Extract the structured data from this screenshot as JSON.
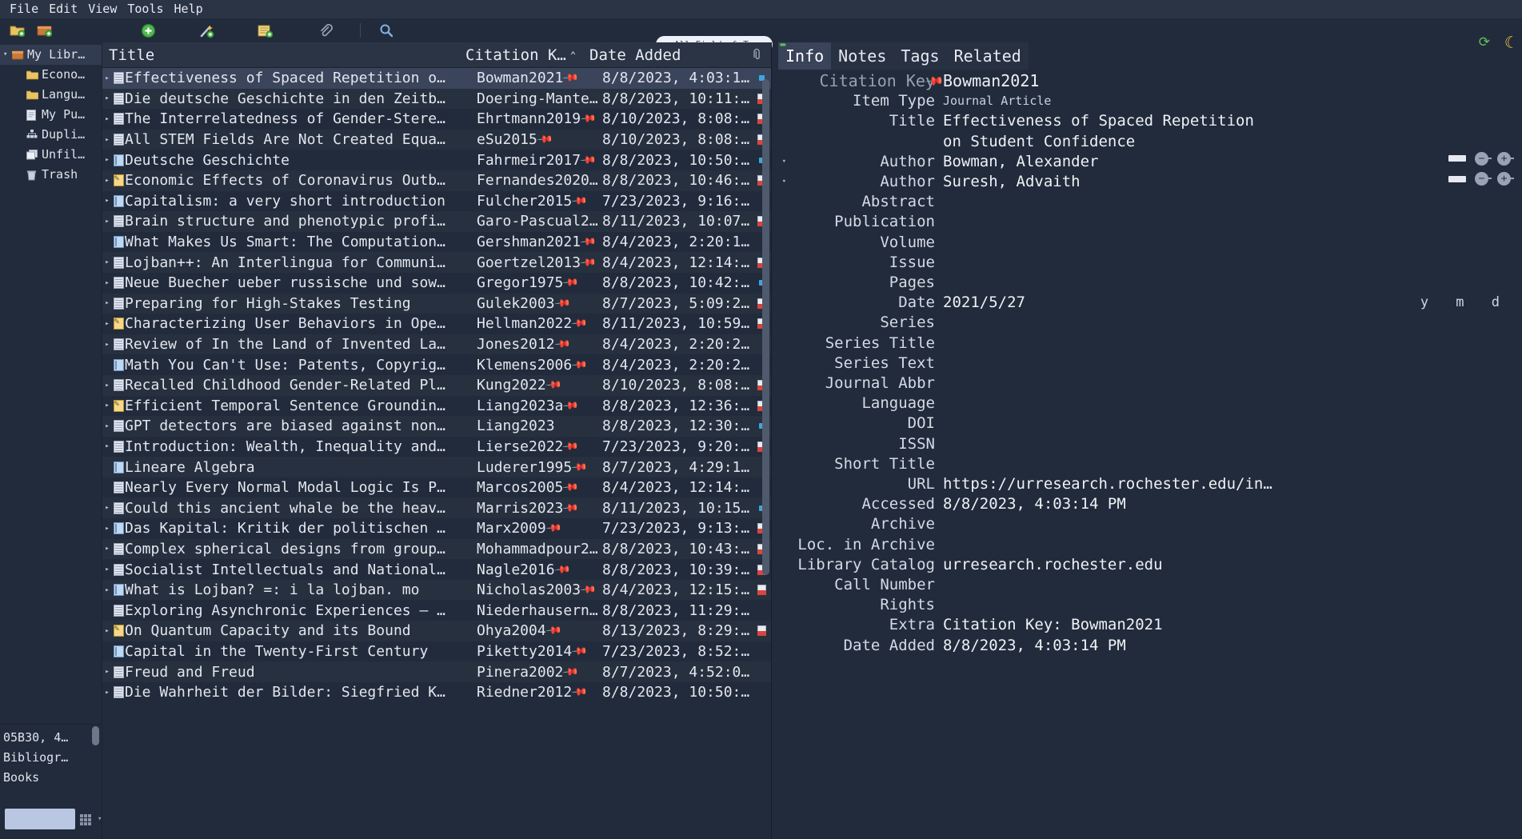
{
  "menu": {
    "items": [
      "File",
      "Edit",
      "View",
      "Tools",
      "Help"
    ]
  },
  "toolbar": {
    "new_collection_label": "new-collection",
    "new_library_label": "new-library",
    "new_item_label": "new-item",
    "add_by_identifier_label": "add-by-identifier",
    "new_note_label": "new-note",
    "add_attachment_label": "add-attachment",
    "advanced_search_label": "advanced-search",
    "sync_label": "sync",
    "appearance_label": "dark-mode"
  },
  "search": {
    "placeholder": "All Fields & Ta",
    "value": "",
    "scope": "All Fields & Ta"
  },
  "sidebar": {
    "collections": [
      {
        "label": "My Libr…",
        "icon": "library-icon",
        "level": 0,
        "twisty": "▾",
        "selected": true
      },
      {
        "label": "Econo…",
        "icon": "folder-icon",
        "level": 1,
        "twisty": "",
        "selected": false
      },
      {
        "label": "Langu…",
        "icon": "folder-icon",
        "level": 1,
        "twisty": "",
        "selected": false
      },
      {
        "label": "My Pu…",
        "icon": "publications-icon",
        "level": 1,
        "twisty": "",
        "selected": false
      },
      {
        "label": "Dupli…",
        "icon": "duplicates-icon",
        "level": 1,
        "twisty": "",
        "selected": false
      },
      {
        "label": "Unfil…",
        "icon": "unfiled-icon",
        "level": 1,
        "twisty": "",
        "selected": false
      },
      {
        "label": "Trash",
        "icon": "trash-icon",
        "level": 1,
        "twisty": "",
        "selected": false
      }
    ],
    "tags": [
      "05B30, 4…",
      "Bibliogr…",
      "Books"
    ],
    "tag_filter_value": ""
  },
  "items_pane": {
    "columns": [
      {
        "key": "title",
        "label": "Title",
        "sorted": false
      },
      {
        "key": "citationKey",
        "label": "Citation K…",
        "sorted": true,
        "direction": "ascending",
        "arrow": "⌃"
      },
      {
        "key": "dateAdded",
        "label": "Date Added",
        "sorted": false
      }
    ],
    "rows": [
      {
        "twisty": "▸",
        "type": "doc",
        "title": "Effectiveness of Spaced Repetition o…",
        "key": "Bowman2021",
        "pinned": true,
        "date": "8/8/2023, 4:03:1…",
        "att": "blue",
        "selected": true
      },
      {
        "twisty": "▸",
        "type": "doc",
        "title": "Die deutsche Geschichte in den Zeitb…",
        "key": "Doering-Mante…",
        "pinned": false,
        "date": "8/8/2023, 10:11:…",
        "att": "pdf"
      },
      {
        "twisty": "▸",
        "type": "doc",
        "title": "The Interrelatedness of Gender-Stere…",
        "key": "Ehrtmann2019",
        "pinned": true,
        "date": "8/10/2023, 8:08:…",
        "att": "pdf"
      },
      {
        "twisty": "▸",
        "type": "doc",
        "title": "All STEM Fields Are Not Created Equa…",
        "key": "eSu2015",
        "pinned": true,
        "date": "8/10/2023, 8:08:…",
        "att": "pdf"
      },
      {
        "twisty": "▸",
        "type": "book",
        "title": "Deutsche Geschichte",
        "key": "Fahrmeir2017",
        "pinned": true,
        "date": "8/8/2023, 10:50:…",
        "att": "blue"
      },
      {
        "twisty": "▸",
        "type": "prep",
        "title": "Economic Effects of Coronavirus Outb…",
        "key": "Fernandes2020…",
        "pinned": false,
        "date": "8/8/2023, 10:46:…",
        "att": "pdf"
      },
      {
        "twisty": "▸",
        "type": "book",
        "title": "Capitalism: a very short introduction",
        "key": "Fulcher2015",
        "pinned": true,
        "date": "7/23/2023, 9:16:…",
        "att": ""
      },
      {
        "twisty": "▸",
        "type": "doc",
        "title": "Brain structure and phenotypic profi…",
        "key": "Garo-Pascual2…",
        "pinned": false,
        "date": "8/11/2023, 10:07…",
        "att": "pdf"
      },
      {
        "twisty": "",
        "type": "book",
        "title": "What Makes Us Smart: The Computation…",
        "key": "Gershman2021",
        "pinned": true,
        "date": "8/4/2023, 2:20:1…",
        "att": ""
      },
      {
        "twisty": "▸",
        "type": "doc",
        "title": "Lojban++: An Interlingua for Communi…",
        "key": "Goertzel2013",
        "pinned": true,
        "date": "8/4/2023, 12:14:…",
        "att": "pdf"
      },
      {
        "twisty": "▸",
        "type": "doc",
        "title": "Neue Buecher ueber russische und sow…",
        "key": "Gregor1975",
        "pinned": true,
        "date": "8/8/2023, 10:42:…",
        "att": "blue"
      },
      {
        "twisty": "▸",
        "type": "doc",
        "title": "Preparing for High-Stakes Testing",
        "key": "Gulek2003",
        "pinned": true,
        "date": "8/7/2023, 5:09:2…",
        "att": "pdf"
      },
      {
        "twisty": "▸",
        "type": "prep",
        "title": "Characterizing User Behaviors in Ope…",
        "key": "Hellman2022",
        "pinned": true,
        "date": "8/11/2023, 10:59…",
        "att": "pdf"
      },
      {
        "twisty": "▸",
        "type": "doc",
        "title": "Review of In the Land of Invented La…",
        "key": "Jones2012",
        "pinned": true,
        "date": "8/4/2023, 2:20:2…",
        "att": ""
      },
      {
        "twisty": "",
        "type": "book",
        "title": "Math You Can't Use: Patents, Copyrig…",
        "key": "Klemens2006",
        "pinned": true,
        "date": "8/4/2023, 2:20:2…",
        "att": ""
      },
      {
        "twisty": "▸",
        "type": "doc",
        "title": "Recalled Childhood Gender-Related Pl…",
        "key": "Kung2022",
        "pinned": true,
        "date": "8/10/2023, 8:08:…",
        "att": "pdf"
      },
      {
        "twisty": "▸",
        "type": "prep",
        "title": "Efficient Temporal Sentence Groundin…",
        "key": "Liang2023a",
        "pinned": true,
        "date": "8/8/2023, 12:36:…",
        "att": "pdf"
      },
      {
        "twisty": "▸",
        "type": "doc",
        "title": "GPT detectors are biased against non…",
        "key": "Liang2023",
        "pinned": false,
        "date": "8/8/2023, 12:30:…",
        "att": "blue"
      },
      {
        "twisty": "▸",
        "type": "doc",
        "title": "Introduction: Wealth, Inequality and…",
        "key": "Lierse2022",
        "pinned": true,
        "date": "7/23/2023, 9:20:…",
        "att": "pdf"
      },
      {
        "twisty": "",
        "type": "book",
        "title": "Lineare Algebra",
        "key": "Luderer1995",
        "pinned": true,
        "date": "8/7/2023, 4:29:1…",
        "att": ""
      },
      {
        "twisty": "",
        "type": "doc",
        "title": "Nearly Every Normal Modal Logic Is P…",
        "key": "Marcos2005",
        "pinned": true,
        "date": "8/4/2023, 12:14:…",
        "att": ""
      },
      {
        "twisty": "▸",
        "type": "doc",
        "title": "Could this ancient whale be the heav…",
        "key": "Marris2023",
        "pinned": true,
        "date": "8/11/2023, 10:15…",
        "att": "blue"
      },
      {
        "twisty": "▸",
        "type": "book",
        "title": "Das Kapital: Kritik der politischen …",
        "key": "Marx2009",
        "pinned": true,
        "date": "7/23/2023, 9:13:…",
        "att": "pdf"
      },
      {
        "twisty": "▸",
        "type": "doc",
        "title": "Complex spherical designs from group…",
        "key": "Mohammadpour2…",
        "pinned": false,
        "date": "8/8/2023, 10:43:…",
        "att": "pdf"
      },
      {
        "twisty": "▸",
        "type": "doc",
        "title": "Socialist Intellectuals and National…",
        "key": "Nagle2016",
        "pinned": true,
        "date": "8/8/2023, 10:39:…",
        "att": "pdf"
      },
      {
        "twisty": "▸",
        "type": "book",
        "title": "What is Lojban? =: i la lojban. mo",
        "key": "Nicholas2003",
        "pinned": true,
        "date": "8/4/2023, 12:15:…",
        "att": "pdf"
      },
      {
        "twisty": "",
        "type": "doc",
        "title": "Exploring Asynchronic Experiences – …",
        "key": "Niederhausern…",
        "pinned": false,
        "date": "8/8/2023, 11:29:…",
        "att": ""
      },
      {
        "twisty": "▸",
        "type": "prep",
        "title": "On Quantum Capacity and its Bound",
        "key": "Ohya2004",
        "pinned": true,
        "date": "8/13/2023, 8:29:…",
        "att": "pdf"
      },
      {
        "twisty": "",
        "type": "book",
        "title": "Capital in the Twenty-First Century",
        "key": "Piketty2014",
        "pinned": true,
        "date": "7/23/2023, 8:52:…",
        "att": ""
      },
      {
        "twisty": "▸",
        "type": "doc",
        "title": "Freud and Freud",
        "key": "Pinera2002",
        "pinned": true,
        "date": "8/7/2023, 4:52:0…",
        "att": ""
      },
      {
        "twisty": "▸",
        "type": "doc",
        "title": "Die Wahrheit der Bilder: Siegfried K…",
        "key": "Riedner2012",
        "pinned": true,
        "date": "8/8/2023, 10:50:…",
        "att": ""
      }
    ]
  },
  "right_pane": {
    "tabs": [
      {
        "label": "Info",
        "active": true
      },
      {
        "label": "Notes",
        "active": false
      },
      {
        "label": "Tags",
        "active": false
      },
      {
        "label": "Related",
        "active": false
      }
    ],
    "citation_key_label": "Citation Key",
    "citation_key_value": "Bowman2021",
    "date_parts": "y m d",
    "fields": [
      {
        "label": "Item Type",
        "value": "Journal Article",
        "style": "small"
      },
      {
        "label": "Title",
        "value": "Effectiveness of Spaced Repetition\non Student Confidence"
      },
      {
        "label": "Author",
        "value": "Bowman, Alexander",
        "kind": "author"
      },
      {
        "label": "Author",
        "value": "Suresh, Advaith",
        "kind": "author"
      },
      {
        "label": "Abstract",
        "value": ""
      },
      {
        "label": "Publication",
        "value": ""
      },
      {
        "label": "Volume",
        "value": ""
      },
      {
        "label": "Issue",
        "value": ""
      },
      {
        "label": "Pages",
        "value": ""
      },
      {
        "label": "Date",
        "value": "2021/5/27",
        "kind": "date"
      },
      {
        "label": "Series",
        "value": ""
      },
      {
        "label": "Series Title",
        "value": ""
      },
      {
        "label": "Series Text",
        "value": ""
      },
      {
        "label": "Journal Abbr",
        "value": ""
      },
      {
        "label": "Language",
        "value": ""
      },
      {
        "label": "DOI",
        "value": ""
      },
      {
        "label": "ISSN",
        "value": ""
      },
      {
        "label": "Short Title",
        "value": ""
      },
      {
        "label": "URL",
        "value": "https://urresearch.rochester.edu/in…"
      },
      {
        "label": "Accessed",
        "value": "8/8/2023, 4:03:14 PM"
      },
      {
        "label": "Archive",
        "value": ""
      },
      {
        "label": "Loc. in Archive",
        "value": ""
      },
      {
        "label": "Library Catalog",
        "value": "urresearch.rochester.edu"
      },
      {
        "label": "Call Number",
        "value": ""
      },
      {
        "label": "Rights",
        "value": ""
      },
      {
        "label": "Extra",
        "value": "Citation Key: Bowman2021"
      },
      {
        "label": "Date Added",
        "value": "8/8/2023, 4:03:14 PM"
      }
    ]
  },
  "colors": {
    "bg": "#222b3b",
    "chrome": "#2b3445",
    "selection": "#3a455c",
    "pin": "#e8566d",
    "sync": "#5fbf5f",
    "moon": "#efc24a",
    "pdf": "#d9453f",
    "blue_dot": "#3ea6dd"
  }
}
